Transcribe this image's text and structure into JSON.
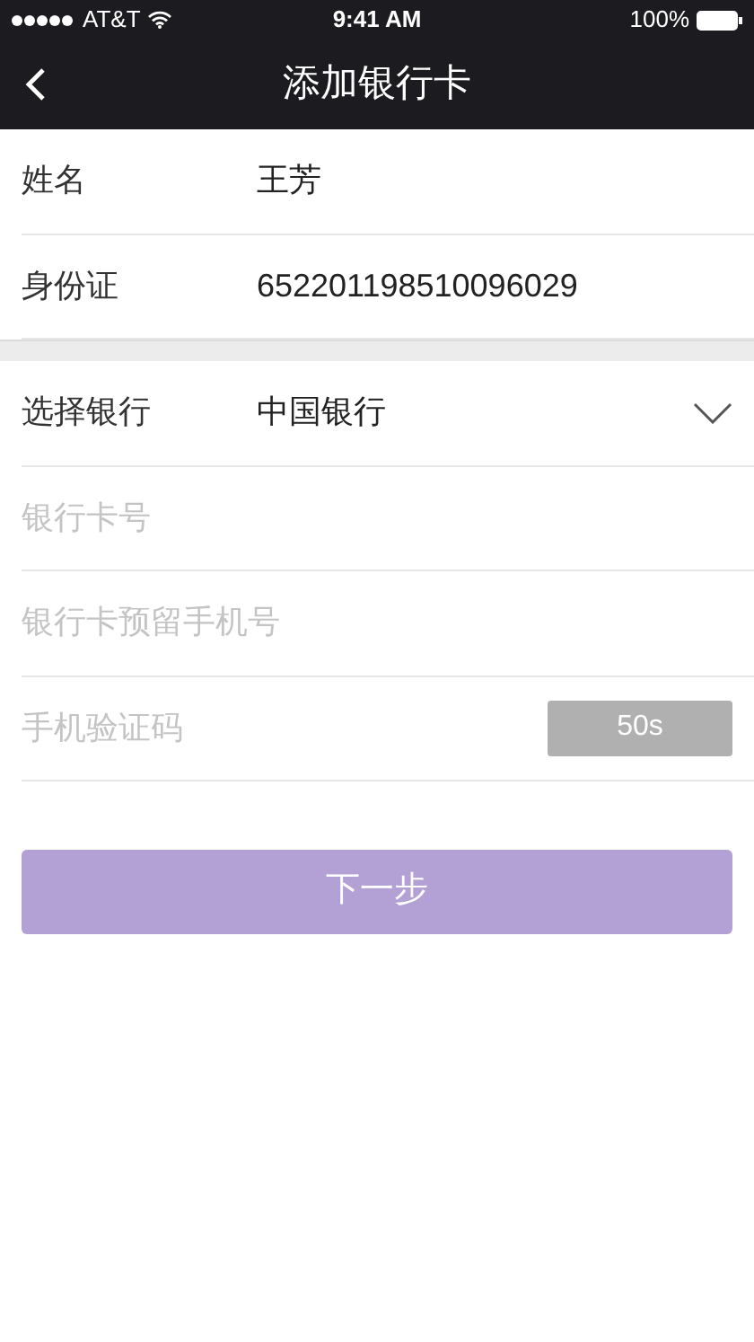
{
  "status_bar": {
    "carrier": "AT&T",
    "time": "9:41 AM",
    "battery": "100%"
  },
  "nav": {
    "title": "添加银行卡"
  },
  "sections": [
    {
      "rows": [
        {
          "kind": "text",
          "label": "姓名",
          "value": "王芳"
        },
        {
          "kind": "text",
          "label": "身份证",
          "value": "652201198510096029"
        }
      ]
    },
    {
      "rows": [
        {
          "kind": "select",
          "label": "选择银行",
          "value": "中国银行"
        },
        {
          "kind": "input",
          "placeholder": "银行卡号"
        },
        {
          "kind": "input",
          "placeholder": "银行卡预留手机号"
        },
        {
          "kind": "code",
          "placeholder": "手机验证码",
          "button": "50s"
        }
      ]
    }
  ],
  "submit": {
    "label": "下一步"
  }
}
